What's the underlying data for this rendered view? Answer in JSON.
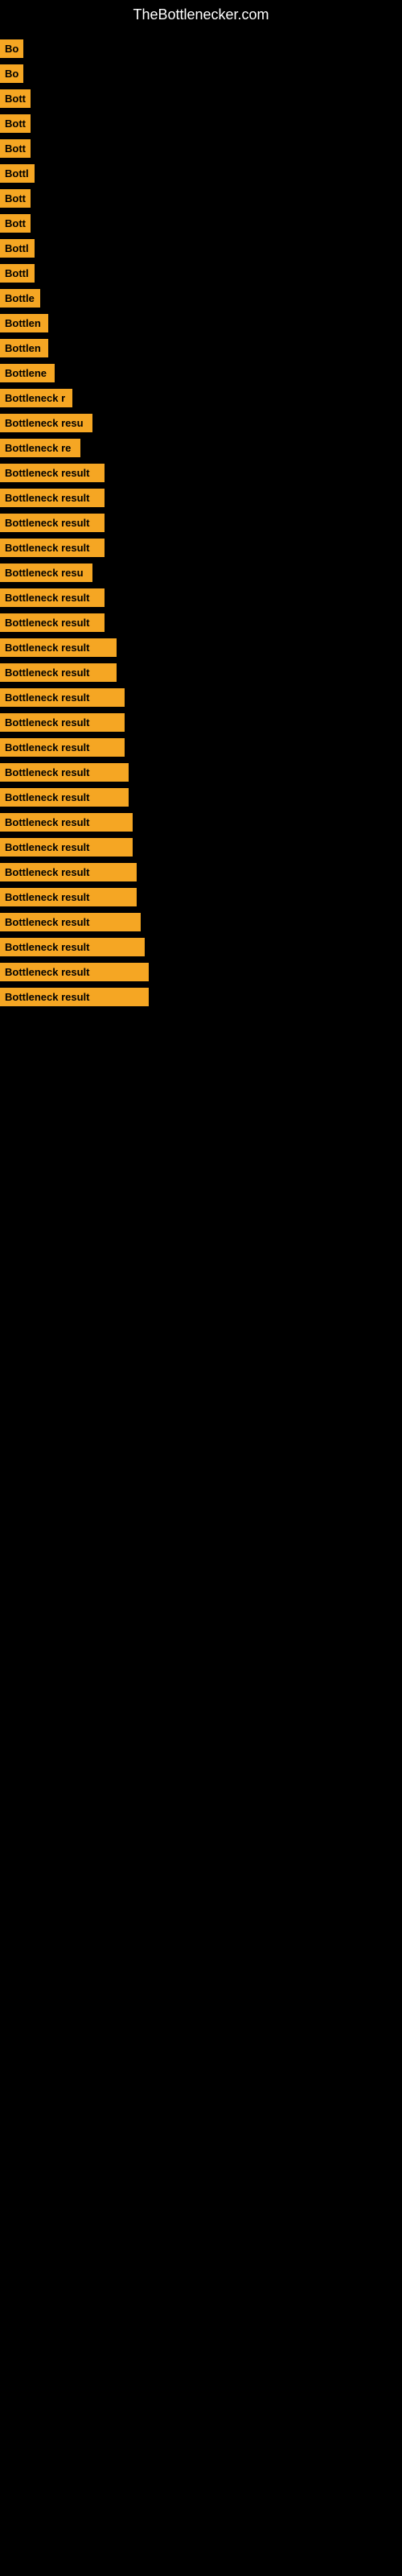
{
  "site": {
    "title": "TheBottlenecker.com"
  },
  "items": [
    {
      "label": "Bo",
      "width": 28
    },
    {
      "label": "Bo",
      "width": 28
    },
    {
      "label": "Bott",
      "width": 38
    },
    {
      "label": "Bott",
      "width": 38
    },
    {
      "label": "Bott",
      "width": 38
    },
    {
      "label": "Bottl",
      "width": 43
    },
    {
      "label": "Bott",
      "width": 38
    },
    {
      "label": "Bott",
      "width": 38
    },
    {
      "label": "Bottl",
      "width": 43
    },
    {
      "label": "Bottl",
      "width": 43
    },
    {
      "label": "Bottle",
      "width": 50
    },
    {
      "label": "Bottlen",
      "width": 60
    },
    {
      "label": "Bottlen",
      "width": 60
    },
    {
      "label": "Bottlene",
      "width": 68
    },
    {
      "label": "Bottleneck r",
      "width": 90
    },
    {
      "label": "Bottleneck resu",
      "width": 115
    },
    {
      "label": "Bottleneck re",
      "width": 100
    },
    {
      "label": "Bottleneck result",
      "width": 130
    },
    {
      "label": "Bottleneck result",
      "width": 130
    },
    {
      "label": "Bottleneck result",
      "width": 130
    },
    {
      "label": "Bottleneck result",
      "width": 130
    },
    {
      "label": "Bottleneck resu",
      "width": 115
    },
    {
      "label": "Bottleneck result",
      "width": 130
    },
    {
      "label": "Bottleneck result",
      "width": 130
    },
    {
      "label": "Bottleneck result",
      "width": 145
    },
    {
      "label": "Bottleneck result",
      "width": 145
    },
    {
      "label": "Bottleneck result",
      "width": 155
    },
    {
      "label": "Bottleneck result",
      "width": 155
    },
    {
      "label": "Bottleneck result",
      "width": 155
    },
    {
      "label": "Bottleneck result",
      "width": 160
    },
    {
      "label": "Bottleneck result",
      "width": 160
    },
    {
      "label": "Bottleneck result",
      "width": 165
    },
    {
      "label": "Bottleneck result",
      "width": 165
    },
    {
      "label": "Bottleneck result",
      "width": 170
    },
    {
      "label": "Bottleneck result",
      "width": 170
    },
    {
      "label": "Bottleneck result",
      "width": 175
    },
    {
      "label": "Bottleneck result",
      "width": 180
    },
    {
      "label": "Bottleneck result",
      "width": 185
    },
    {
      "label": "Bottleneck result",
      "width": 185
    }
  ]
}
